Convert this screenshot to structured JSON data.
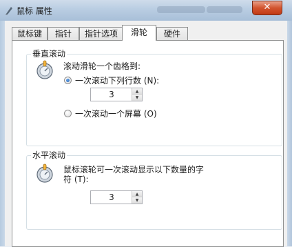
{
  "window": {
    "title": "鼠标 属性",
    "close_glyph": "✕",
    "close_icon": "close-icon",
    "app_icon": "mouse-properties-icon"
  },
  "tabs": [
    {
      "label": "鼠标键",
      "active": false
    },
    {
      "label": "指针",
      "active": false
    },
    {
      "label": "指针选项",
      "active": false
    },
    {
      "label": "滑轮",
      "active": true
    },
    {
      "label": "硬件",
      "active": false
    }
  ],
  "vertical_scroll": {
    "legend": "垂直滚动",
    "icon": "scroll-wheel-icon",
    "description": "滚动滑轮一个齿格到:",
    "option_lines": {
      "label": "一次滚动下列行数 (N):",
      "checked": true
    },
    "lines_value": "3",
    "option_screen": {
      "label": "一次滚动一个屏幕 (O)",
      "checked": false
    }
  },
  "horizontal_scroll": {
    "legend": "水平滚动",
    "icon": "scroll-wheel-icon",
    "description_line1": "鼠标滚轮可一次滚动显示以下数量的字",
    "description_line2": "符 (T):",
    "chars_value": "3"
  },
  "colors": {
    "title_gradient_mid": "#b9cde2",
    "close_button": "#d2542e",
    "panel_bg": "#ffffff",
    "group_border": "#d5dfe5"
  }
}
